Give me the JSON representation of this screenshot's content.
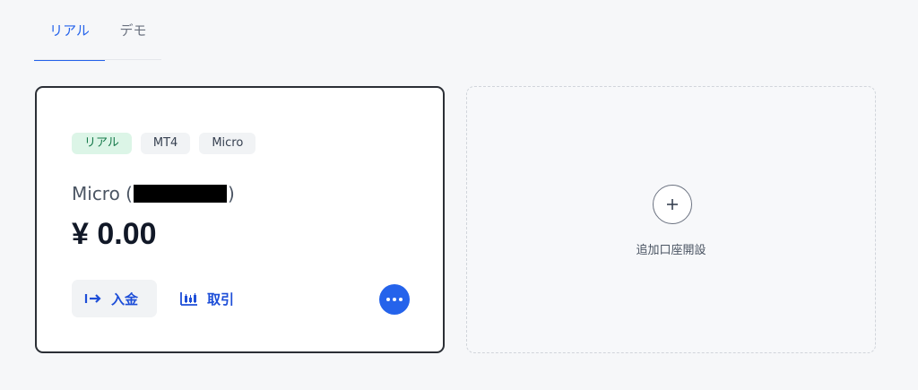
{
  "tabs": [
    {
      "label": "リアル",
      "active": true
    },
    {
      "label": "デモ",
      "active": false
    }
  ],
  "account_card": {
    "badges": [
      "リアル",
      "MT4",
      "Micro"
    ],
    "name_prefix": "Micro (",
    "name_suffix": ")",
    "balance": "¥ 0.00",
    "deposit_label": "入金",
    "trade_label": "取引",
    "more_icon": "ellipsis-icon"
  },
  "add_account": {
    "label": "追加口座開設",
    "icon": "plus-icon"
  },
  "colors": {
    "accent": "#2563eb",
    "badge_real_bg": "#dcf5e7",
    "badge_real_text": "#16794a"
  }
}
